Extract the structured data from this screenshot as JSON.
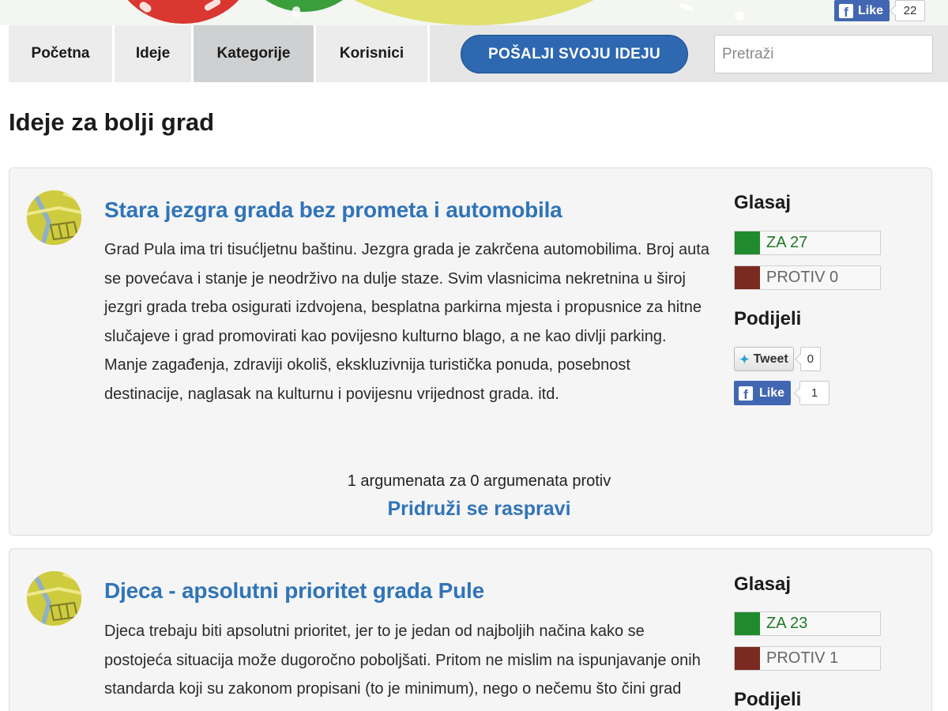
{
  "header": {
    "facebook_like": {
      "label": "Like",
      "count": "22"
    }
  },
  "nav": {
    "items": [
      {
        "label": "Početna"
      },
      {
        "label": "Ideje"
      },
      {
        "label": "Kategorije",
        "active": true
      },
      {
        "label": "Korisnici"
      }
    ],
    "submit_label": "POŠALJI SVOJU IDEJU",
    "search_placeholder": "Pretraži"
  },
  "page_title": "Ideje za bolji grad",
  "ideas": [
    {
      "title": "Stara jezgra grada bez prometa i automobila",
      "body": "Grad Pula ima tri tisućljetnu baštinu. Jezgra grada je zakrčena automobilima. Broj auta se povećava i stanje je neodrživo na dulje staze. Svim vlasnicima nekretnina u široj jezgri grada treba osigurati izdvojena, besplatna parkirna mjesta i propusnice za hitne slučajeve i grad promovirati kao povijesno kulturno blago, a ne kao divlji parking. Manje zagađenja, zdraviji okoliš, ekskluzivnija turistička ponuda, posebnost destinacije, naglasak na kulturnu i povijesnu vrijednost grada. itd.",
      "arguments": "1 argumenata za 0 argumenata protiv",
      "join_label": "Pridruži se raspravi",
      "vote_heading": "Glasaj",
      "vote_for": "ZA 27",
      "vote_against": "PROTIV 0",
      "share_heading": "Podijeli",
      "tweet_label": "Tweet",
      "tweet_count": "0",
      "like_label": "Like",
      "like_count": "1"
    },
    {
      "title": "Djeca - apsolutni prioritet grada Pule",
      "body": "Djeca trebaju biti apsolutni prioritet, jer to je jedan od najboljih načina kako se postojeća situacija može dugoročno poboljšati. Pritom ne mislim na ispunjavanje onih standarda koji su zakonom propisani (to je minimum), nego o nečemu što čini grad Pulom...",
      "vote_heading": "Glasaj",
      "vote_for": "ZA 23",
      "vote_against": "PROTIV 1",
      "share_heading": "Podijeli"
    }
  ],
  "colors": {
    "link": "#3074b8",
    "submit_button": "#2d68b0",
    "vote_for": "#1f8b2c",
    "vote_against": "#7a2a20",
    "facebook": "#4267b2"
  }
}
